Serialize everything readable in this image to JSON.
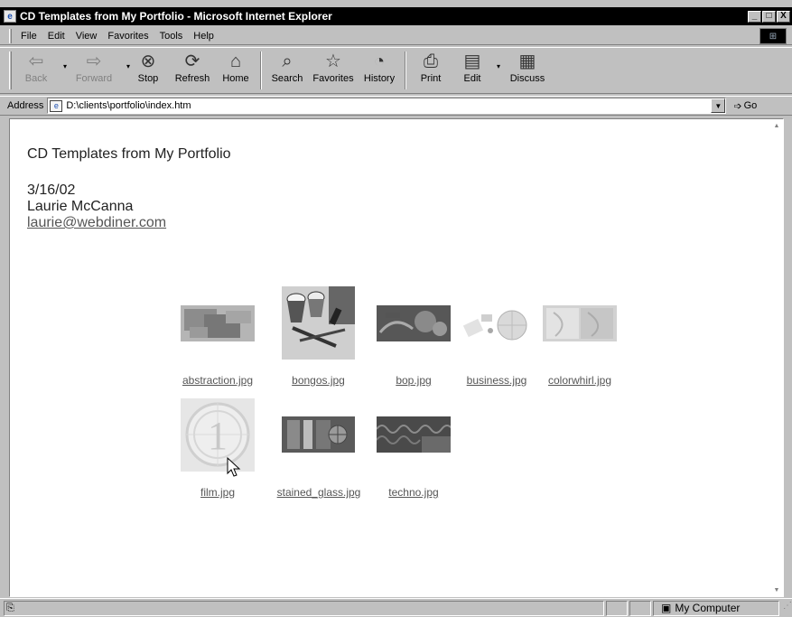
{
  "window": {
    "title": "CD Templates from My Portfolio - Microsoft Internet Explorer",
    "buttons": {
      "minimize": "_",
      "maximize": "□",
      "close": "X"
    }
  },
  "menubar": {
    "items": [
      {
        "label": "File"
      },
      {
        "label": "Edit"
      },
      {
        "label": "View"
      },
      {
        "label": "Favorites"
      },
      {
        "label": "Tools"
      },
      {
        "label": "Help"
      }
    ]
  },
  "toolbar": {
    "buttons": [
      {
        "label": "Back",
        "icon": "back-arrow-icon",
        "glyph": "⇦",
        "enabled": false,
        "dropdown": true
      },
      {
        "label": "Forward",
        "icon": "forward-arrow-icon",
        "glyph": "⇨",
        "enabled": false,
        "dropdown": true
      },
      {
        "label": "Stop",
        "icon": "stop-icon",
        "glyph": "⊗",
        "enabled": true
      },
      {
        "label": "Refresh",
        "icon": "refresh-icon",
        "glyph": "⟳",
        "enabled": true
      },
      {
        "label": "Home",
        "icon": "home-icon",
        "glyph": "⌂",
        "enabled": true
      },
      {
        "label": "Search",
        "icon": "search-icon",
        "glyph": "⌕",
        "enabled": true
      },
      {
        "label": "Favorites",
        "icon": "favorites-icon",
        "glyph": "☆",
        "enabled": true
      },
      {
        "label": "History",
        "icon": "history-icon",
        "glyph": "◔",
        "enabled": true
      },
      {
        "label": "Print",
        "icon": "print-icon",
        "glyph": "⎙",
        "enabled": true
      },
      {
        "label": "Edit",
        "icon": "edit-icon",
        "glyph": "▤",
        "enabled": true,
        "dropdown": true
      },
      {
        "label": "Discuss",
        "icon": "discuss-icon",
        "glyph": "▦",
        "enabled": true
      }
    ]
  },
  "address": {
    "label": "Address",
    "value": "D:\\clients\\portfolio\\index.htm",
    "go_label": "Go"
  },
  "page": {
    "title": "CD Templates from My Portfolio",
    "date": "3/16/02",
    "author": "Laurie McCanna",
    "email": "laurie@webdiner.com",
    "thumbnails": [
      {
        "file": "abstraction.jpg"
      },
      {
        "file": "bongos.jpg"
      },
      {
        "file": "bop.jpg"
      },
      {
        "file": "business.jpg"
      },
      {
        "file": "colorwhirl.jpg"
      },
      {
        "file": "film.jpg",
        "digit": "1"
      },
      {
        "file": "stained_glass.jpg"
      },
      {
        "file": "techno.jpg"
      }
    ]
  },
  "statusbar": {
    "icon": "page-icon",
    "zone": "My Computer"
  }
}
